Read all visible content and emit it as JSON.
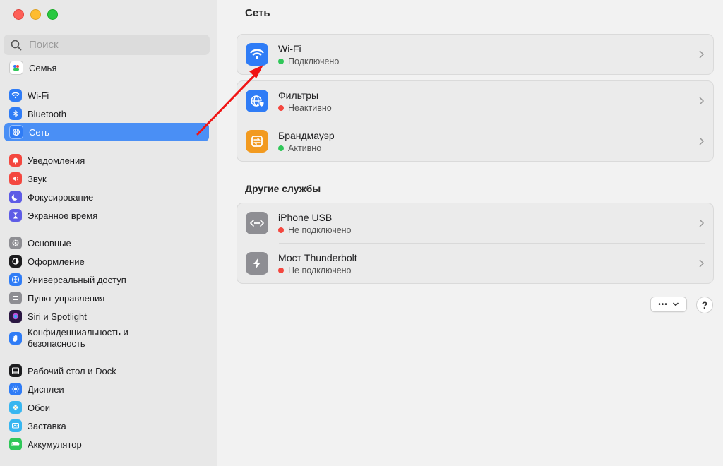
{
  "search": {
    "placeholder": "Поиск"
  },
  "sidebar": {
    "items": [
      {
        "label": "Семья",
        "icon": "family-icon",
        "color": "#f2f2f2"
      },
      {
        "label": "Wi-Fi",
        "icon": "wifi-icon",
        "color": "#2f7cf6"
      },
      {
        "label": "Bluetooth",
        "icon": "bluetooth-icon",
        "color": "#2f7cf6"
      },
      {
        "label": "Сеть",
        "icon": "globe-icon",
        "color": "#2f7cf6",
        "active": true
      },
      {
        "label": "Уведомления",
        "icon": "bell-icon",
        "color": "#f4473f"
      },
      {
        "label": "Звук",
        "icon": "speaker-icon",
        "color": "#f4473f"
      },
      {
        "label": "Фокусирование",
        "icon": "moon-icon",
        "color": "#5e5ce6"
      },
      {
        "label": "Экранное время",
        "icon": "hourglass-icon",
        "color": "#5e5ce6"
      },
      {
        "label": "Основные",
        "icon": "gear-icon",
        "color": "#8e8e93"
      },
      {
        "label": "Оформление",
        "icon": "appearance-icon",
        "color": "#1d1d1f"
      },
      {
        "label": "Универсальный доступ",
        "icon": "accessibility-icon",
        "color": "#2f7cf6"
      },
      {
        "label": "Пункт управления",
        "icon": "control-center-icon",
        "color": "#8e8e93"
      },
      {
        "label": "Siri и Spotlight",
        "icon": "siri-icon",
        "color": "#b13ad6"
      },
      {
        "label": "Конфиденциальность и безопасность",
        "icon": "hand-icon",
        "color": "#2f7cf6"
      },
      {
        "label": "Рабочий стол и Dock",
        "icon": "dock-icon",
        "color": "#1d1d1f"
      },
      {
        "label": "Дисплеи",
        "icon": "sun-icon",
        "color": "#2f7cf6"
      },
      {
        "label": "Обои",
        "icon": "flower-icon",
        "color": "#38b6f0"
      },
      {
        "label": "Заставка",
        "icon": "screensaver-icon",
        "color": "#38b6f0"
      },
      {
        "label": "Аккумулятор",
        "icon": "battery-icon",
        "color": "#30c759"
      }
    ]
  },
  "main": {
    "title": "Сеть",
    "services": [
      {
        "name": "Wi-Fi",
        "status": "Подключено",
        "status_color": "#30c759",
        "icon": "wifi-icon",
        "icon_color": "#2f7cf6"
      }
    ],
    "security": [
      {
        "name": "Фильтры",
        "status": "Неактивно",
        "status_color": "#f4473f",
        "icon": "globe-shield-icon",
        "icon_color": "#2f7cf6"
      },
      {
        "name": "Брандмауэр",
        "status": "Активно",
        "status_color": "#30c759",
        "icon": "firewall-icon",
        "icon_color": "#f29a1f"
      }
    ],
    "other_title": "Другие службы",
    "other": [
      {
        "name": "iPhone USB",
        "status": "Не подключено",
        "status_color": "#f4473f",
        "icon": "usb-ethernet-icon",
        "icon_color": "#8e8e93"
      },
      {
        "name": "Мост Thunderbolt",
        "status": "Не подключено",
        "status_color": "#f4473f",
        "icon": "thunderbolt-icon",
        "icon_color": "#8e8e93"
      }
    ],
    "more_label": "•••",
    "help_label": "?"
  },
  "annotation": {
    "color": "#f01414"
  }
}
